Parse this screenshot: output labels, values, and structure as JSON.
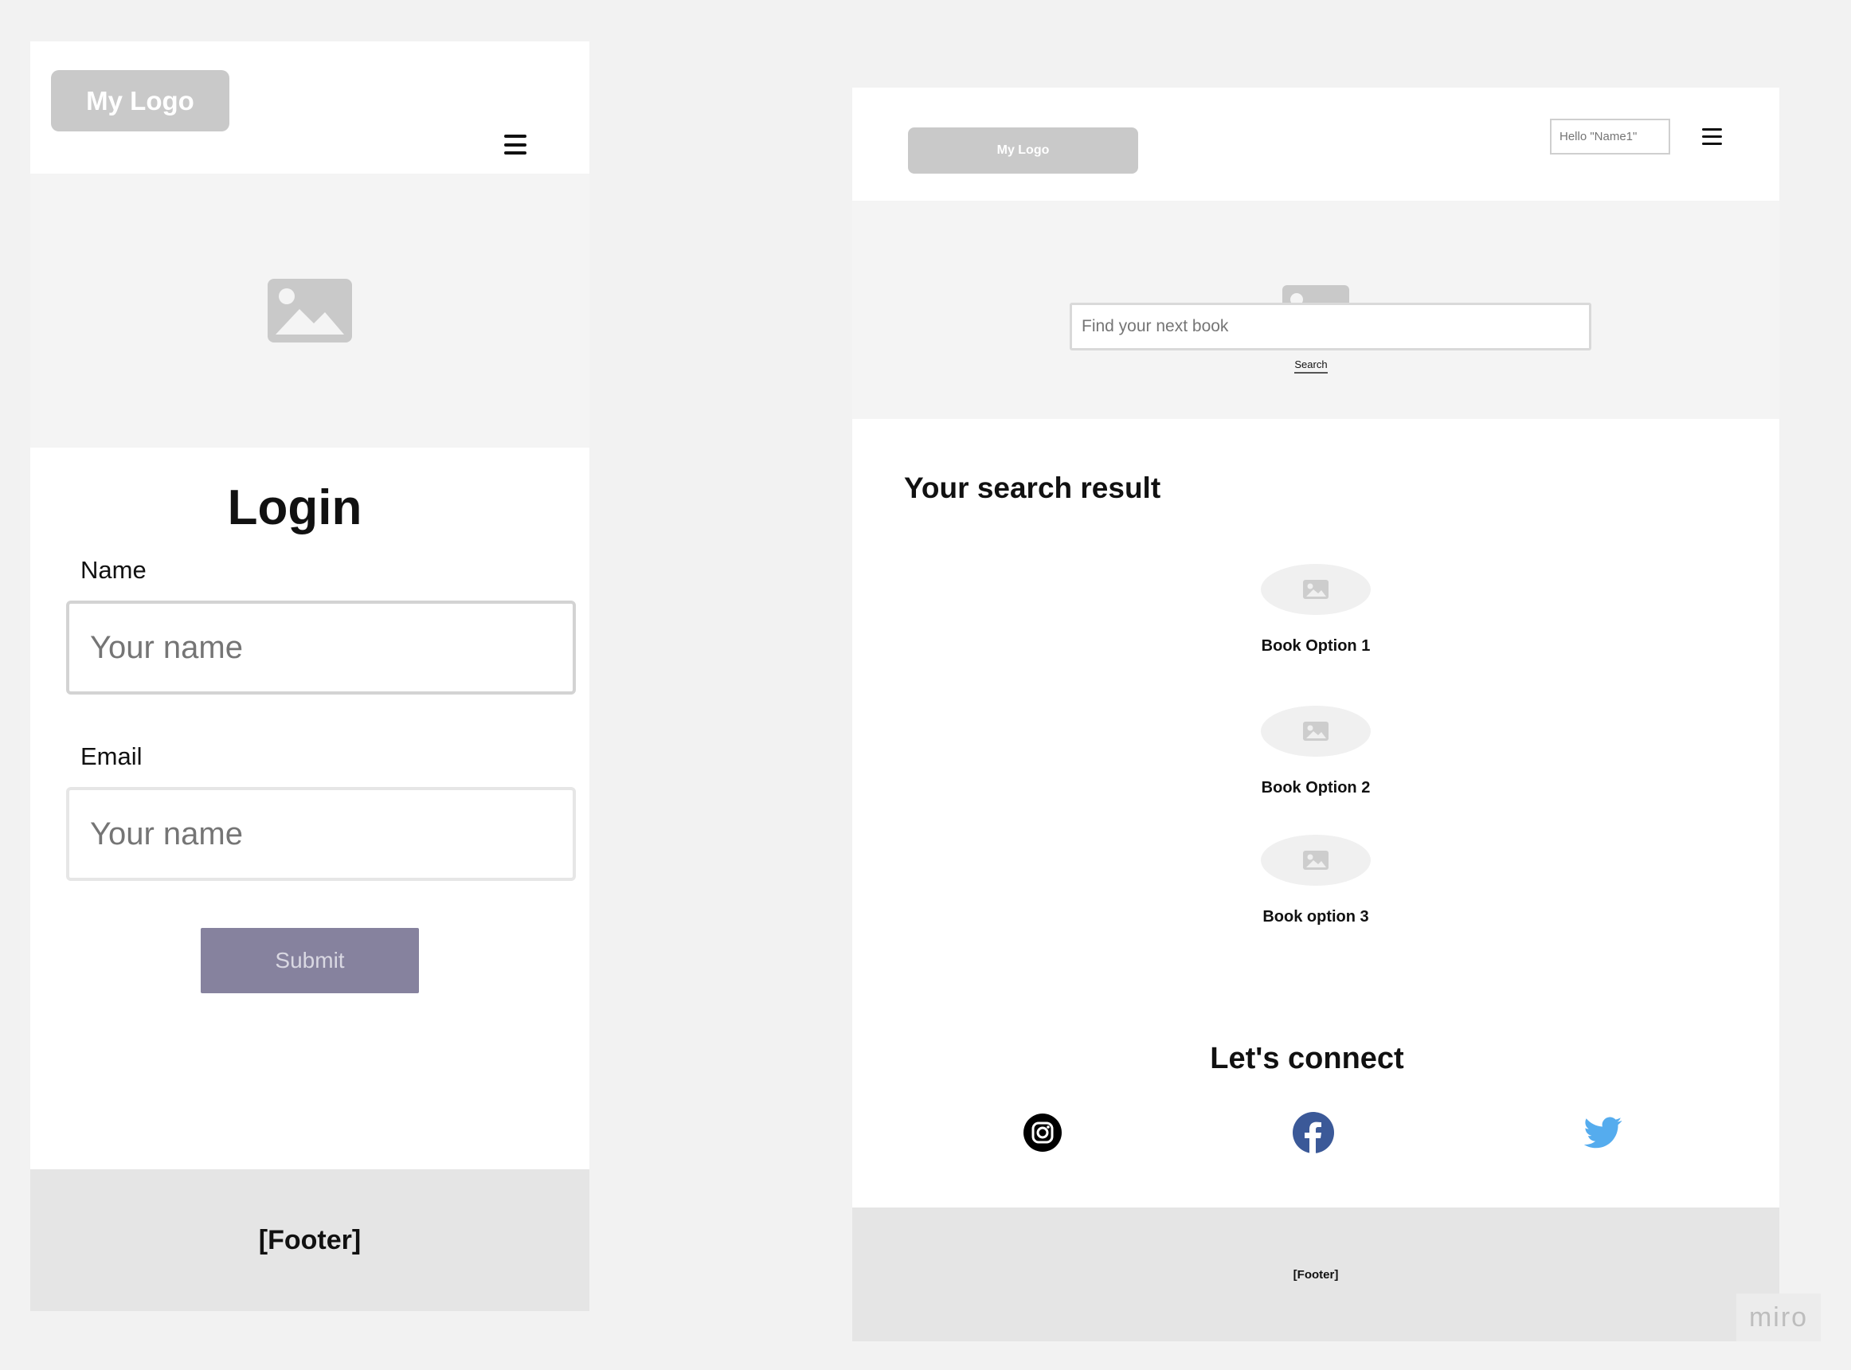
{
  "colors": {
    "canvas": "#f2f2f2",
    "panel": "#ffffff",
    "hero": "#f4f4f4",
    "logo_bg": "#c9c9c9",
    "footer_bg": "#e5e5e5",
    "submit_bg": "#86829e",
    "instagram": "#000000",
    "facebook": "#3b5998",
    "twitter": "#55acee"
  },
  "mobile": {
    "header": {
      "logo": "My Logo",
      "menu_icon": "hamburger-menu-icon"
    },
    "hero": {
      "icon": "image-placeholder-icon"
    },
    "login": {
      "title": "Login",
      "name_label": "Name",
      "name_placeholder": "Your name",
      "email_label": "Email",
      "email_placeholder": "Your name",
      "submit": "Submit"
    },
    "footer": "[Footer]"
  },
  "desktop": {
    "header": {
      "logo": "My Logo",
      "greeting_placeholder": "Hello \"Name1\"",
      "menu_icon": "hamburger-menu-icon"
    },
    "search": {
      "placeholder": "Find your next book",
      "button": "Search"
    },
    "results": {
      "title": "Your search result",
      "books": [
        {
          "label": "Book Option 1",
          "icon": "image-placeholder-icon"
        },
        {
          "label": "Book Option 2",
          "icon": "image-placeholder-icon"
        },
        {
          "label": "Book option 3",
          "icon": "image-placeholder-icon"
        }
      ]
    },
    "connect": {
      "title": "Let's connect",
      "icons": [
        "instagram-icon",
        "facebook-icon",
        "twitter-icon"
      ]
    },
    "footer": "[Footer]"
  },
  "watermark": "miro"
}
